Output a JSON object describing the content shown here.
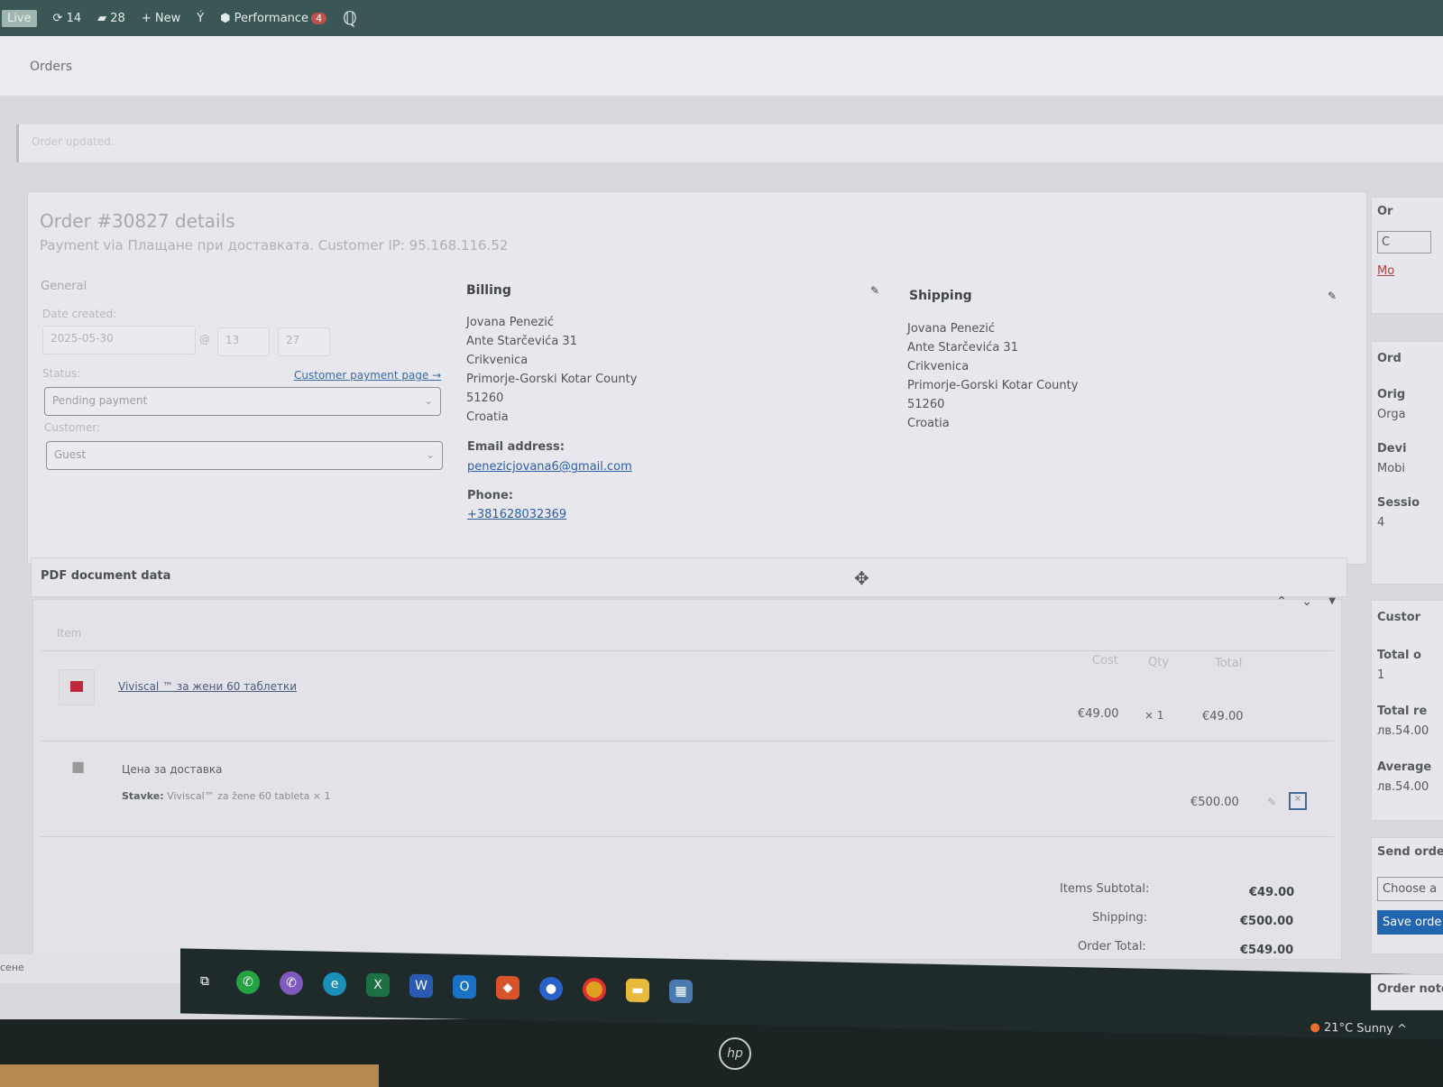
{
  "adminbar": {
    "live": "Live",
    "updates": "14",
    "comments": "28",
    "new": "New",
    "performance": "Performance",
    "performance_badge": "4"
  },
  "header": {
    "title": "Orders"
  },
  "notice": "Order updated.",
  "order": {
    "title": "Order #30827 details",
    "subtitle": "Payment via Плащане при доставката. Customer IP: 95.168.116.52",
    "general": {
      "heading": "General",
      "date_label": "Date created:",
      "date": "2025-05-30",
      "at": "@",
      "hour": "13",
      "minute": "27",
      "status_label": "Status:",
      "payment_link": "Customer payment page →",
      "status": "Pending payment",
      "customer_label": "Customer:",
      "customer": "Guest"
    },
    "billing": {
      "heading": "Billing",
      "lines": [
        "Jovana Penezić",
        "Ante Starčevića 31",
        "Crikvenica",
        "Primorje-Gorski Kotar County",
        "51260",
        "Croatia"
      ],
      "email_label": "Email address:",
      "email": "penezicjovana6@gmail.com",
      "phone_label": "Phone:",
      "phone": "+381628032369"
    },
    "shipping": {
      "heading": "Shipping",
      "lines": [
        "Jovana Penezić",
        "Ante Starčevića 31",
        "Crikvenica",
        "Primorje-Gorski Kotar County",
        "51260",
        "Croatia"
      ]
    }
  },
  "pdf": {
    "heading": "PDF document data"
  },
  "items": {
    "headers": {
      "item": "Item",
      "cost": "Cost",
      "qty": "Qty",
      "total": "Total"
    },
    "product": {
      "name": "Viviscal ™ за жени 60 таблетки",
      "cost": "€49.00",
      "qty": "× 1",
      "total": "€49.00"
    },
    "shipping": {
      "name": "Цена за доставка",
      "meta_label": "Stavke:",
      "meta_value": "Viviscal™ za žene 60 tableta × 1",
      "total": "€500.00"
    },
    "totals": [
      {
        "label": "Items Subtotal:",
        "value": "€49.00"
      },
      {
        "label": "Shipping:",
        "value": "€500.00"
      },
      {
        "label": "Order Total:",
        "value": "€549.00"
      }
    ]
  },
  "sidebar": {
    "box1_title": "Or",
    "box1_btn": "C",
    "box1_link": "Mo",
    "attribution_title": "Ord",
    "origin_label": "Orig",
    "origin": "Orga",
    "device_label": "Devi",
    "device": "Mobi",
    "session_label": "Sessio",
    "session": "4",
    "customer_title": "Custor",
    "total_orders_label": "Total o",
    "total_orders": "1",
    "total_rev_label": "Total re",
    "total_rev": "лв.54.00",
    "avg_label": "Average",
    "avg": "лв.54.00",
    "send_title": "Send orde",
    "choose": "Choose a",
    "save": "Save orde",
    "notes_title": "Order note"
  },
  "taskbar": {
    "left_text": "сене",
    "weather": "21°C  Sunny"
  },
  "brand": "hp"
}
